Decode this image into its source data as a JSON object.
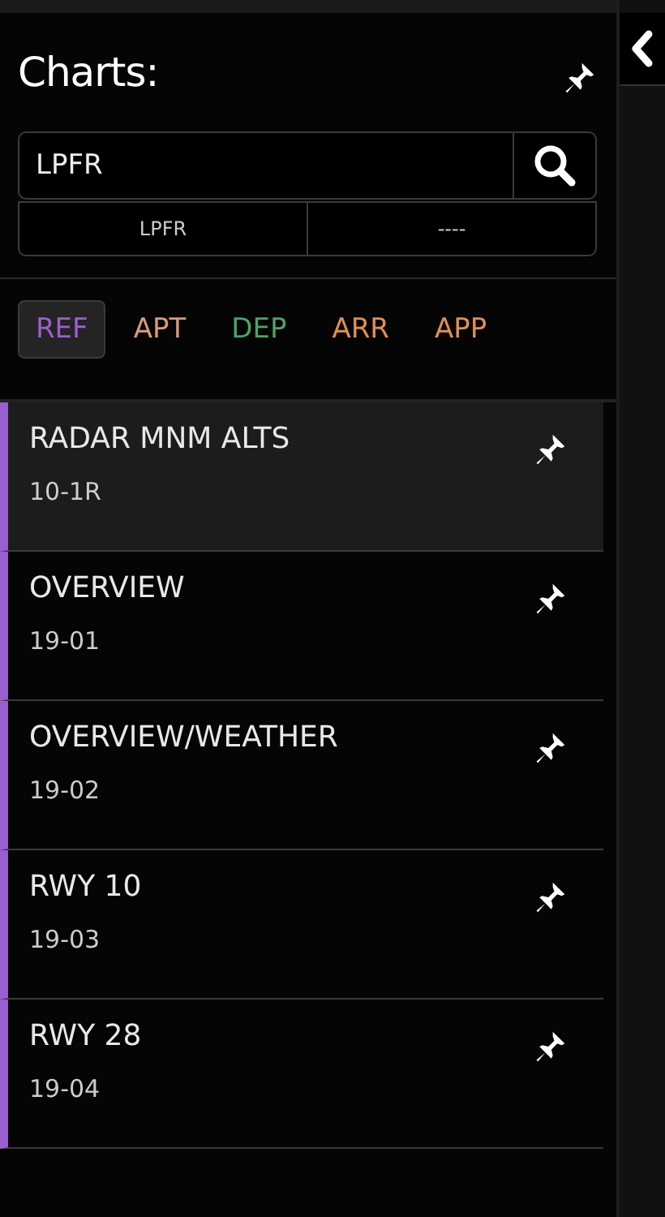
{
  "title": "Charts:",
  "search": {
    "value": "LPFR"
  },
  "airports": [
    {
      "label": "LPFR"
    },
    {
      "label": "----"
    }
  ],
  "tabs": [
    {
      "label": "REF",
      "selected": true,
      "color": "#9a5fcf"
    },
    {
      "label": "APT",
      "selected": false,
      "color": "#d69a80"
    },
    {
      "label": "DEP",
      "selected": false,
      "color": "#4fa268"
    },
    {
      "label": "ARR",
      "selected": false,
      "color": "#df8f55"
    },
    {
      "label": "APP",
      "selected": false,
      "color": "#df8f55"
    }
  ],
  "charts": [
    {
      "name": "RADAR MNM ALTS",
      "code": "10-1R",
      "selected": true
    },
    {
      "name": "OVERVIEW",
      "code": "19-01",
      "selected": false
    },
    {
      "name": "OVERVIEW/WEATHER",
      "code": "19-02",
      "selected": false
    },
    {
      "name": "RWY 10",
      "code": "19-03",
      "selected": false
    },
    {
      "name": "RWY 28",
      "code": "19-04",
      "selected": false
    }
  ]
}
